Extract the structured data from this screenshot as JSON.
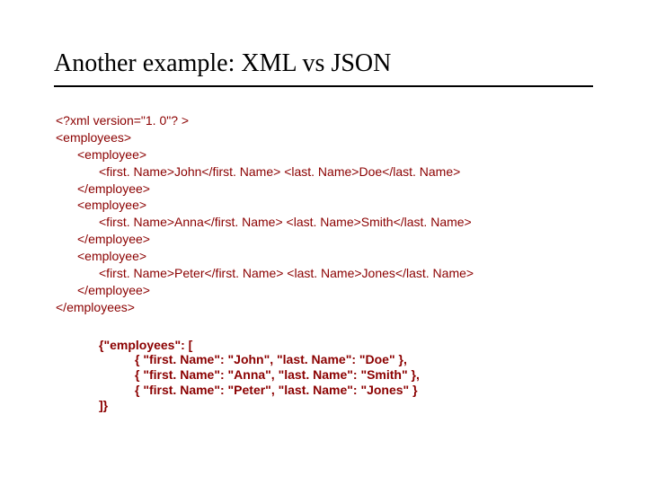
{
  "title": "Another example: XML vs JSON",
  "xml": {
    "l0": "<?xml version=\"1. 0\"? >",
    "l1": "<employees>",
    "l2": "<employee>",
    "l3": "<first. Name>John</first. Name> <last. Name>Doe</last. Name>",
    "l4": "</employee>",
    "l5": "<employee>",
    "l6": "<first. Name>Anna</first. Name> <last. Name>Smith</last. Name>",
    "l7": "</employee>",
    "l8": "<employee>",
    "l9": "<first. Name>Peter</first. Name> <last. Name>Jones</last. Name>",
    "l10": "</employee>",
    "l11": "</employees>"
  },
  "json": {
    "l0": "{\"employees\": [",
    "l1": "{ \"first. Name\": \"John\", \"last. Name\": \"Doe\" },",
    "l2": "{ \"first. Name\": \"Anna\", \"last. Name\": \"Smith\" },",
    "l3": "{ \"first. Name\": \"Peter\", \"last. Name\": \"Jones\" }",
    "l4": "]}"
  }
}
